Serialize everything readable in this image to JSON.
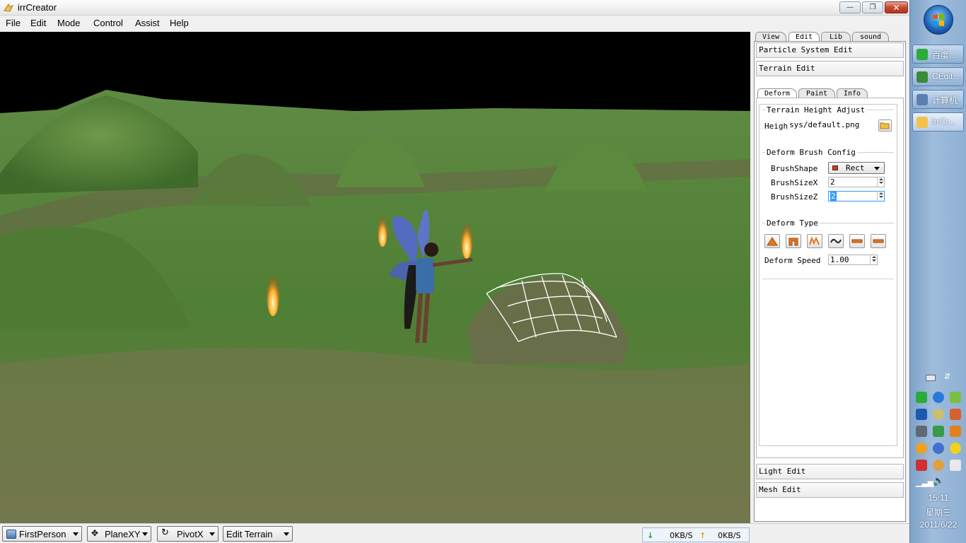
{
  "window": {
    "title": "irrCreator",
    "buttons": {
      "minimize": "—",
      "maximize": "❐",
      "close": "✕"
    }
  },
  "menu": [
    "File",
    "Edit",
    "Mode",
    "Control",
    "Assist",
    "Help"
  ],
  "panel": {
    "top_tabs": [
      "View",
      "Edit",
      "Lib",
      "sound"
    ],
    "active_top_tab": "Edit",
    "sections": {
      "particle": "Particle System Edit",
      "terrain": "Terrain Edit",
      "light": "Light Edit",
      "mesh": "Mesh Edit"
    },
    "terrain_tabs": [
      "Deform",
      "Paint",
      "Info"
    ],
    "active_terrain_tab": "Deform",
    "height_adjust": {
      "title": "Terrain Height Adjust",
      "label": "Heigh",
      "value": "sys/default.png"
    },
    "brush_config": {
      "title": "Deform Brush Config",
      "shape_label": "BrushShape",
      "shape_value": "Rect",
      "size_x_label": "BrushSizeX",
      "size_x_value": "2",
      "size_z_label": "BrushSizeZ",
      "size_z_value": "2"
    },
    "deform_type": {
      "title": "Deform Type",
      "speed_label": "Deform Speed",
      "speed_value": "1.00"
    }
  },
  "statusbar": {
    "camera_mode": "FirstPerson",
    "plane": "PlaneXY",
    "pivot": "PivotX",
    "edit_mode": "Edit Terrain",
    "download": "0KB/S",
    "upload": "0KB/S"
  },
  "taskbar": {
    "items": [
      "百度...",
      "CEdit...",
      "计算机",
      "irrCr..."
    ],
    "active_item": "irrCr...",
    "time": "15:11",
    "weekday": "星期三",
    "date": "2011/6/22"
  },
  "colors": {
    "accent_orange": "#e07820",
    "selection_blue": "#3399ff",
    "grass_green": "#5a8a3a"
  }
}
